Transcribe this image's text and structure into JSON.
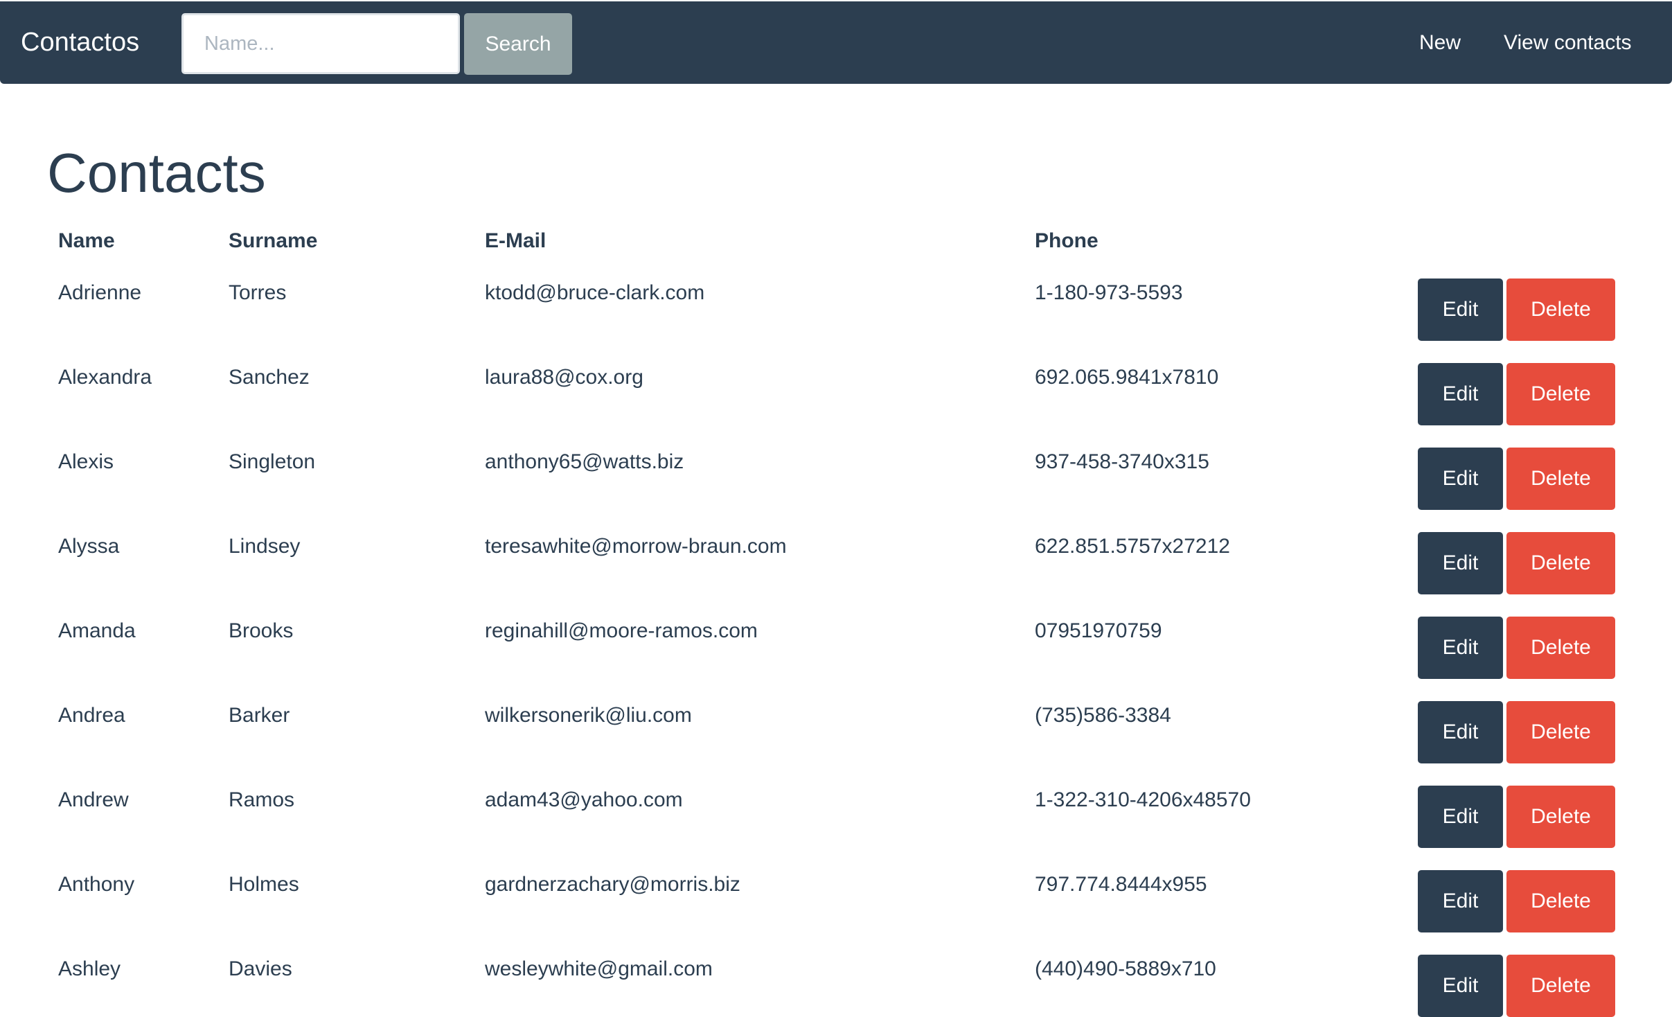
{
  "navbar": {
    "brand": "Contactos",
    "search_placeholder": "Name...",
    "search_label": "Search",
    "links": [
      {
        "label": "New"
      },
      {
        "label": "View contacts"
      }
    ]
  },
  "page": {
    "title": "Contacts"
  },
  "table": {
    "headers": {
      "name": "Name",
      "surname": "Surname",
      "email": "E-Mail",
      "phone": "Phone"
    },
    "edit_label": "Edit",
    "delete_label": "Delete",
    "rows": [
      {
        "name": "Adrienne",
        "surname": "Torres",
        "email": "ktodd@bruce-clark.com",
        "phone": "1-180-973-5593"
      },
      {
        "name": "Alexandra",
        "surname": "Sanchez",
        "email": "laura88@cox.org",
        "phone": "692.065.9841x7810"
      },
      {
        "name": "Alexis",
        "surname": "Singleton",
        "email": "anthony65@watts.biz",
        "phone": "937-458-3740x315"
      },
      {
        "name": "Alyssa",
        "surname": "Lindsey",
        "email": "teresawhite@morrow-braun.com",
        "phone": "622.851.5757x27212"
      },
      {
        "name": "Amanda",
        "surname": "Brooks",
        "email": "reginahill@moore-ramos.com",
        "phone": "07951970759"
      },
      {
        "name": "Andrea",
        "surname": "Barker",
        "email": "wilkersonerik@liu.com",
        "phone": "(735)586-3384"
      },
      {
        "name": "Andrew",
        "surname": "Ramos",
        "email": "adam43@yahoo.com",
        "phone": "1-322-310-4206x48570"
      },
      {
        "name": "Anthony",
        "surname": "Holmes",
        "email": "gardnerzachary@morris.biz",
        "phone": "797.774.8444x955"
      },
      {
        "name": "Ashley",
        "surname": "Davies",
        "email": "wesleywhite@gmail.com",
        "phone": "(440)490-5889x710"
      }
    ]
  }
}
